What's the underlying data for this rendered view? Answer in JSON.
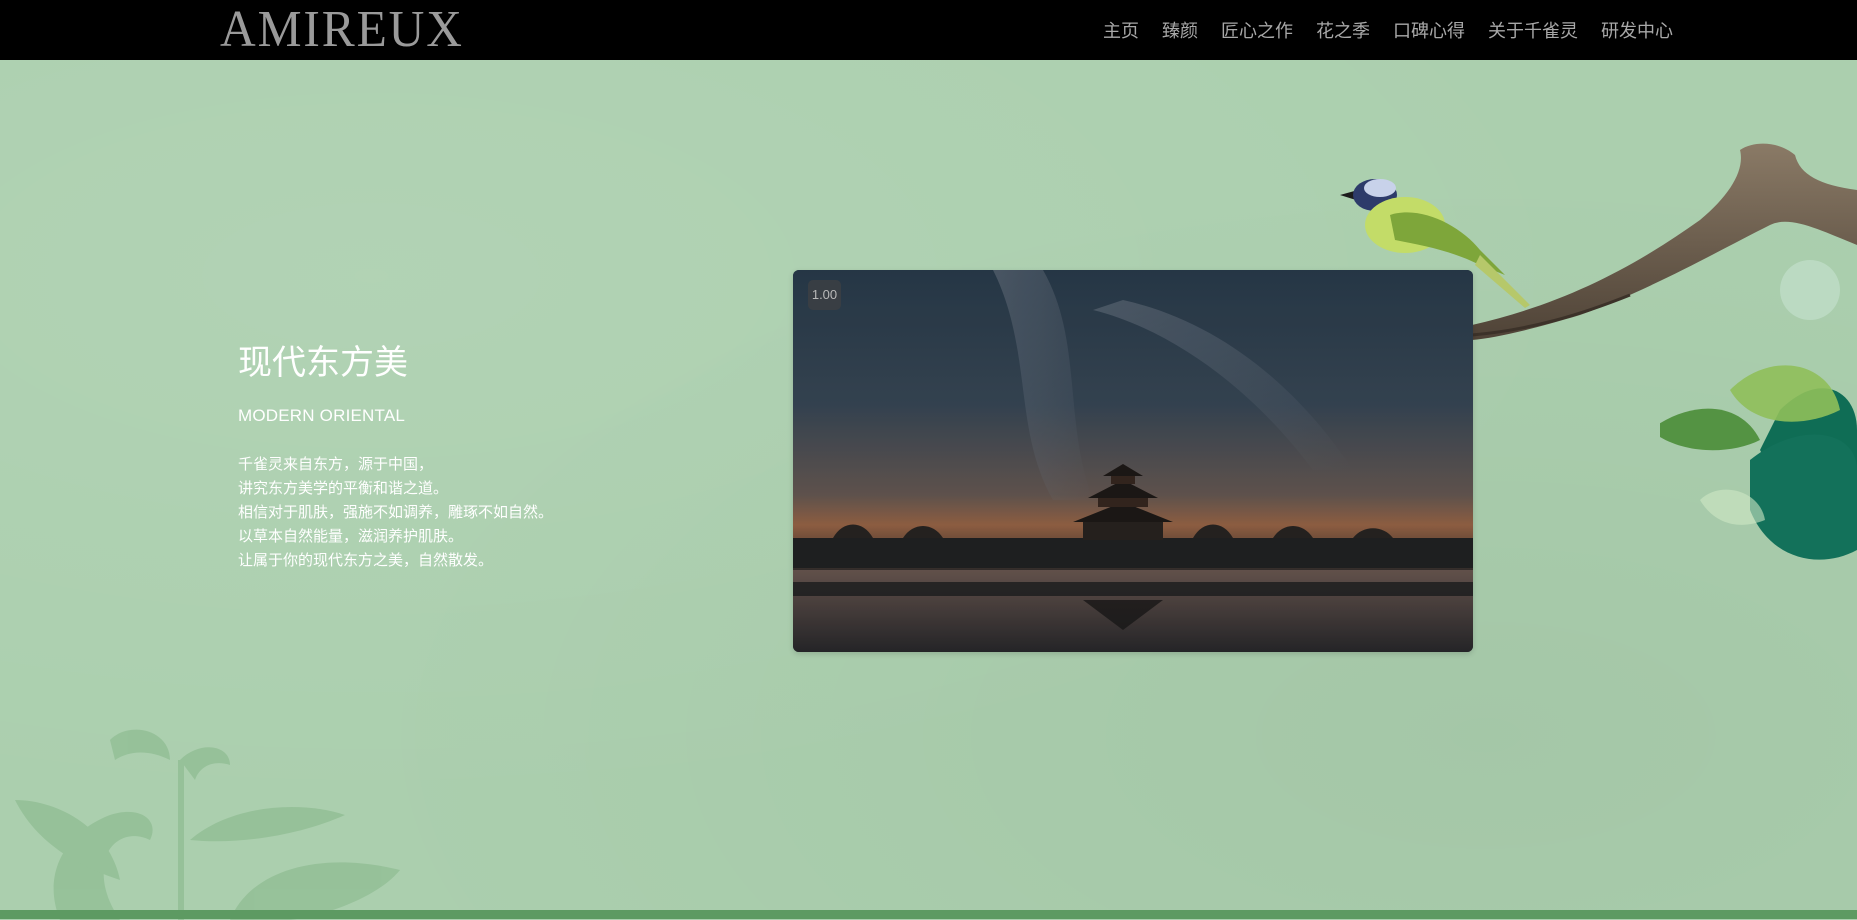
{
  "header": {
    "logo": "AMIREUX",
    "nav": [
      "主页",
      "臻颜",
      "匠心之作",
      "花之季",
      "口碑心得",
      "关于千雀灵",
      "研发中心"
    ]
  },
  "hero": {
    "title": "现代东方美",
    "subtitle": "MODERN ORIENTAL",
    "lines": [
      "千雀灵来自东方，源于中国，",
      "讲究东方美学的平衡和谐之道。",
      "相信对于肌肤，强施不如调养，雕琢不如自然。",
      "以草本自然能量，滋润养护肌肤。",
      "让属于你的现代东方之美，自然散发。"
    ]
  },
  "video": {
    "speed_badge": "1.00"
  },
  "colors": {
    "background": "#abcfae",
    "header": "#000000",
    "nav_text": "#a8a8a8",
    "logo": "#9a9a9a",
    "bottom_strip": "#5d9a62"
  },
  "icons": [
    "bird-illustration",
    "branch-illustration",
    "leaf-illustration",
    "palace-photo"
  ]
}
